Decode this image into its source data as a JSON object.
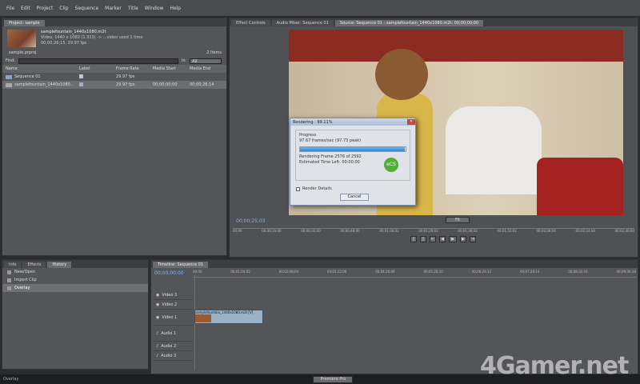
{
  "menu": [
    "File",
    "Edit",
    "Project",
    "Clip",
    "Sequence",
    "Marker",
    "Title",
    "Window",
    "Help"
  ],
  "project": {
    "tabs": [
      "Project: sample"
    ],
    "clip_name": "samplefountain_1440x1080.m2t",
    "clip_info_1": "Video, 1440 x 1080 (1.333) -> ...video used 1 time",
    "clip_info_2": "00;00;26;15, 29.97 fps",
    "file_name": "sample.prproj",
    "items_count": "2 Items",
    "find_label": "Find:",
    "in_label": "In:",
    "in_value": "All",
    "columns": [
      "Name",
      "Label",
      "Frame Rate",
      "Media Start",
      "Media End"
    ],
    "rows": [
      {
        "name": "Sequence 01",
        "fps": "29.97 fps",
        "start": "",
        "end": ""
      },
      {
        "name": "samplefountain_1440x1080...",
        "fps": "29.97 fps",
        "start": "00;00;00;00",
        "end": "00;00;26;14"
      }
    ]
  },
  "history": {
    "tabs": [
      "Info",
      "Effects",
      "History"
    ],
    "items": [
      "New/Open",
      "Import Clip",
      "Overlay"
    ]
  },
  "monitor": {
    "tabs": [
      "Effect Controls",
      "Audio Mixer: Sequence 01",
      "Source: Sequence 01 - samplefountain_1440x1080.m2t: 00;00;00;00"
    ],
    "timecode": "00;00;25;03",
    "fit_label": "Fit",
    "ruler_labels": [
      "00;00",
      "00;00;16;00",
      "00;00;32;00",
      "00;00;48;00",
      "00;01;04;02",
      "00;01;20;02",
      "00;01;36;02",
      "00;01;52;02",
      "00;02;08;04",
      "00;02;24;04",
      "00;02;40;04"
    ]
  },
  "render_dialog": {
    "title": "Rendering : 99.11%",
    "group_label": "Progress",
    "rate": "97.67 frames/sec (97.73 peak)",
    "progress": 0.991,
    "frame_status": "Rendering Frame 2576 of 2592",
    "time_left": "Estimated Time Left: 00:00:00",
    "details_label": "Render Details",
    "cancel_label": "Cancel",
    "badge": "eCS"
  },
  "timeline": {
    "tab": "Timeline: Sequence 01",
    "timecode": "00;00;00;00",
    "ruler_labels": [
      "00;00",
      "00;01;04;02",
      "00;02;08;04",
      "00;03;12;06",
      "00;04;16;08",
      "00;05;20;10",
      "00;06;24;12",
      "00;07;28;14",
      "00;08;32;16",
      "00;09;36;18"
    ],
    "video_tracks": [
      "Video 3",
      "Video 2",
      "Video 1"
    ],
    "audio_tracks": [
      "Audio 1",
      "Audio 2",
      "Audio 3"
    ],
    "clip_label": "samplefountain_1440x1080.m2t [V]"
  },
  "taskbar": {
    "app": "Premiere Pro",
    "status": "Overlay"
  },
  "watermark": "4Gamer.net"
}
